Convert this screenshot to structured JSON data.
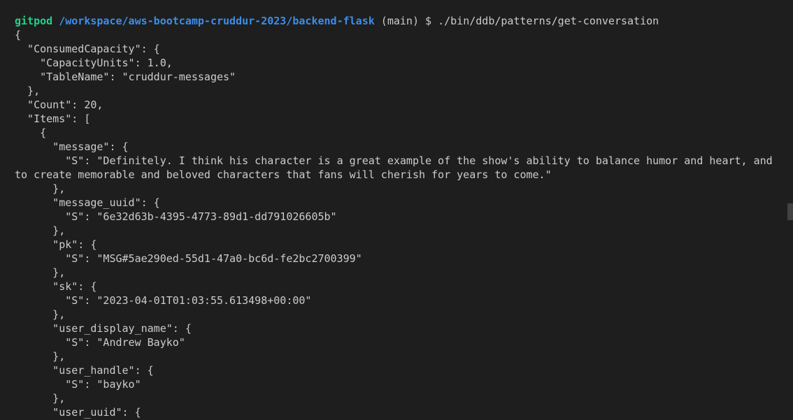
{
  "prompt": {
    "user": "gitpod",
    "path": "/workspace/aws-bootcamp-cruddur-2023/backend-flask",
    "branch": "(main) $",
    "command": "./bin/ddb/patterns/get-conversation"
  },
  "output_lines": [
    "{",
    "  \"ConsumedCapacity\": {",
    "    \"CapacityUnits\": 1.0,",
    "    \"TableName\": \"cruddur-messages\"",
    "  },",
    "  \"Count\": 20,",
    "  \"Items\": [",
    "    {",
    "      \"message\": {",
    "        \"S\": \"Definitely. I think his character is a great example of the show's ability to balance humor and heart, and",
    "to create memorable and beloved characters that fans will cherish for years to come.\"",
    "      },",
    "      \"message_uuid\": {",
    "        \"S\": \"6e32d63b-4395-4773-89d1-dd791026605b\"",
    "      },",
    "      \"pk\": {",
    "        \"S\": \"MSG#5ae290ed-55d1-47a0-bc6d-fe2bc2700399\"",
    "      },",
    "      \"sk\": {",
    "        \"S\": \"2023-04-01T01:03:55.613498+00:00\"",
    "      },",
    "      \"user_display_name\": {",
    "        \"S\": \"Andrew Bayko\"",
    "      },",
    "      \"user_handle\": {",
    "        \"S\": \"bayko\"",
    "      },",
    "      \"user_uuid\": {"
  ]
}
